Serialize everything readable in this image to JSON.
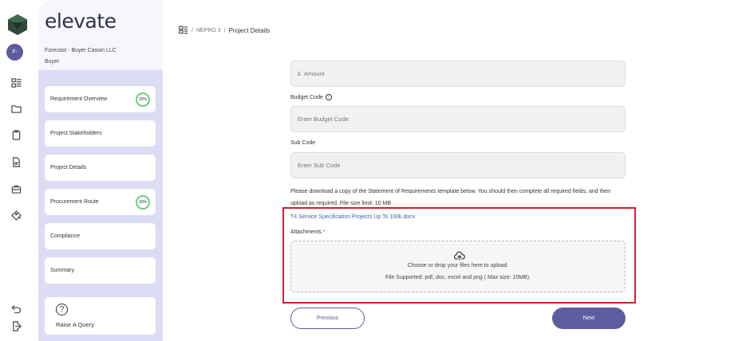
{
  "app": {
    "brand": "elevate",
    "avatar_initials": "F-"
  },
  "colors": {
    "accent": "#5b5d9e",
    "sidebar_bg": "#dcdcf4",
    "progress_ring": "#6bcf7f",
    "highlight_border": "#d0202a",
    "link": "#4b5ca8"
  },
  "rail": {
    "icons": [
      "hierarchy-icon",
      "folder-icon",
      "clipboard-icon",
      "document-icon",
      "briefcase-icon",
      "tag-icon",
      "undo-icon",
      "logout-icon"
    ]
  },
  "sidebar": {
    "organisation": "Forecast - Buyer Cassin LLC",
    "role": "Buyer",
    "items": [
      {
        "label": "Requirement Overview",
        "progress": "20%"
      },
      {
        "label": "Project Stakeholders"
      },
      {
        "label": "Project Details"
      },
      {
        "label": "Procurement Route",
        "progress": "30%"
      },
      {
        "label": "Compliance"
      },
      {
        "label": "Summary"
      }
    ],
    "query": {
      "icon": "question-icon",
      "label": "Raise A Query"
    }
  },
  "breadcrumb": {
    "project": "NEPRO 3",
    "current": "Project Details"
  },
  "form": {
    "amount_placeholder": "£  Amount",
    "budget_code_label": "Budget Code",
    "budget_code_placeholder": "Enter Budget Code",
    "sub_code_label": "Sub Code",
    "sub_code_placeholder": "Enter Sub Code",
    "instructions": "Please download a copy of the Statement of Requirements template below. You should then complete all required fields, and then upload as required. File size limit: 10 MB",
    "template_file": "T4 Service Specification Projects Up To 100k.docx",
    "attachments_label": "Attachments",
    "required_mark": "*",
    "dropzone_text": "Choose or drop your files here to upload.",
    "dropzone_subtext": "File Supported: pdf, doc, excel and png ( Max size: 10MB)."
  },
  "actions": {
    "previous": "Previous",
    "next": "Next"
  }
}
